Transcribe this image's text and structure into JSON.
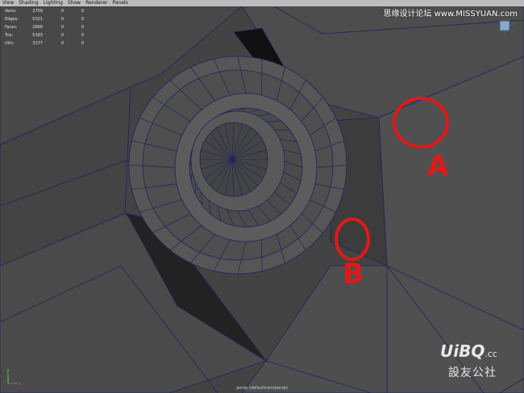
{
  "menu": [
    "View",
    "Shading",
    "Lighting",
    "Show",
    "Renderer",
    "Panels"
  ],
  "hud": [
    {
      "label": "Verts:",
      "v1": "2759",
      "v2": "0",
      "v3": "0"
    },
    {
      "label": "Edges:",
      "v1": "5321",
      "v2": "0",
      "v3": "0"
    },
    {
      "label": "Faces:",
      "v1": "2666",
      "v2": "0",
      "v3": "0"
    },
    {
      "label": "Tris:",
      "v1": "5183",
      "v2": "0",
      "v3": "0"
    },
    {
      "label": "UVs:",
      "v1": "3177",
      "v2": "0",
      "v3": "0"
    }
  ],
  "camera_label": "persp (defaultcam/persp)",
  "annotations": {
    "a": "A",
    "b": "B"
  },
  "watermark": {
    "top": "思缘设计论坛 www.MISSYUAN.com",
    "brand": "UiBQ",
    "brand_suffix": ".cc",
    "cn": "設友公社"
  },
  "axis": {
    "x": "x",
    "y": "y"
  },
  "colors": {
    "wire": "#1e2360",
    "annotation": "#e21818",
    "menubar": "#bcbcbc"
  }
}
